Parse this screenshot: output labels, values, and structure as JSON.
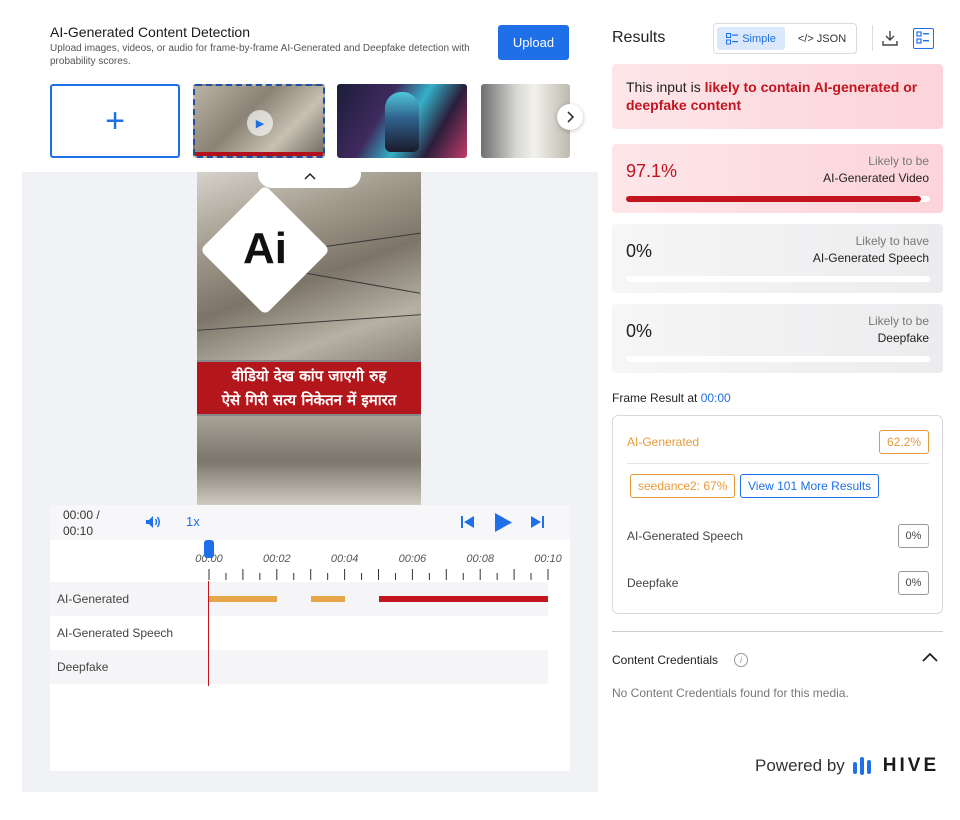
{
  "header": {
    "title": "AI-Generated Content Detection",
    "subtitle": "Upload images, videos, or audio for frame-by-frame AI-Generated and Deepfake detection with probability scores.",
    "upload_label": "Upload"
  },
  "thumbnails": {
    "add_icon": "+",
    "items": [
      {
        "name": "street-video",
        "selected": true
      },
      {
        "name": "cyberpunk-portrait"
      },
      {
        "name": "living-room"
      }
    ]
  },
  "video": {
    "overlay_logo": "Ai",
    "banner_line1": "वीडियो देख कांप जाएगी रुह",
    "banner_line2": "ऐसे गिरी सत्य निकेतन में इमारत"
  },
  "player": {
    "time": "00:00 /\n00:10",
    "speed": "1x",
    "ticks": [
      "00:00",
      "00:02",
      "00:04",
      "00:06",
      "00:08",
      "00:10"
    ],
    "rows": [
      {
        "label": "AI-Generated"
      },
      {
        "label": "AI-Generated Speech"
      },
      {
        "label": "Deepfake"
      }
    ],
    "segments": [
      {
        "row": 0,
        "start": 0.0,
        "end": 2.0,
        "color": "#e8a64a"
      },
      {
        "row": 0,
        "start": 3.0,
        "end": 4.0,
        "color": "#e8a64a"
      },
      {
        "row": 0,
        "start": 5.0,
        "end": 10.0,
        "color": "#c4141f"
      }
    ],
    "duration_seconds": 10,
    "playhead_seconds": 0
  },
  "results": {
    "title": "Results",
    "view_simple": "Simple",
    "view_json": "</> JSON",
    "alert_prefix": "This input is ",
    "alert_bold": "likely to contain AI-generated or deepfake content",
    "cards": [
      {
        "pct": "97.1%",
        "l1": "Likely to be",
        "l2": "AI-Generated Video",
        "fill": 0.971
      },
      {
        "pct": "0%",
        "l1": "Likely to have",
        "l2": "AI-Generated Speech",
        "fill": 0
      },
      {
        "pct": "0%",
        "l1": "Likely to be",
        "l2": "Deepfake",
        "fill": 0
      }
    ],
    "frame_label": "Frame Result at ",
    "frame_time": "00:00",
    "frame": {
      "ai_label": "AI-Generated",
      "ai_pct": "62.2%",
      "model_chip": "seedance2: 67%",
      "more_label": "View 101 More Results",
      "speech_label": "AI-Generated Speech",
      "speech_pct": "0%",
      "deepfake_label": "Deepfake",
      "deepfake_pct": "0%"
    },
    "cc_title": "Content Credentials",
    "cc_text": "No Content Credentials found for this media.",
    "powered_by": "Powered by",
    "brand": "HIVE"
  },
  "colors": {
    "accent": "#1f6fe8",
    "danger": "#c4141f",
    "warning": "#e59a3a"
  }
}
